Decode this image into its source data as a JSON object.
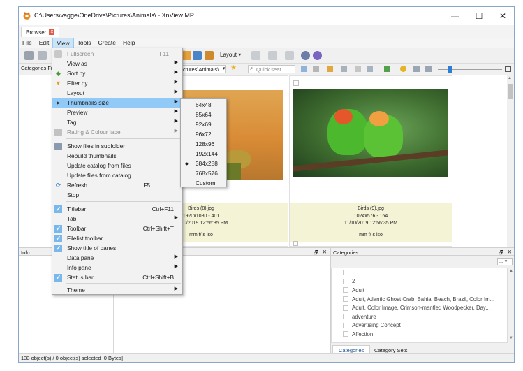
{
  "window": {
    "title": "C:\\Users\\vagge\\OneDrive\\Pictures\\Animals\\ - XnView MP",
    "minimize": "—",
    "maximize": "☐",
    "close": "✕"
  },
  "tab": {
    "label": "Browser",
    "close": "x"
  },
  "menubar": [
    "File",
    "Edit",
    "View",
    "Tools",
    "Create",
    "Help"
  ],
  "toolbar": {
    "layout_label": "Layout",
    "path_text": "ctures\\Animals\\",
    "search_placeholder": "Quick sear..."
  },
  "left_pane": {
    "categories_filter_label": "Categories Fi"
  },
  "view_menu": [
    {
      "label": "Fullscreen",
      "shortcut": "F11",
      "disabled": true,
      "icon": "fullscreen-icon"
    },
    {
      "label": "View as",
      "submenu": true
    },
    {
      "label": "Sort by",
      "submenu": true,
      "icon": "sort-icon"
    },
    {
      "label": "Filter by",
      "submenu": true,
      "icon": "filter-icon"
    },
    {
      "label": "Layout",
      "submenu": true
    },
    {
      "label": "Thumbnails size",
      "submenu": true,
      "highlighted": true
    },
    {
      "label": "Preview",
      "submenu": true
    },
    {
      "label": "Tag",
      "submenu": true
    },
    {
      "label": "Rating & Colour label",
      "submenu": true,
      "disabled": true,
      "icon": "rating-icon"
    },
    {
      "separator": true
    },
    {
      "label": "Show files in subfolder",
      "icon": "subfolder-icon"
    },
    {
      "label": "Rebuild thumbnails"
    },
    {
      "label": "Update catalog from files"
    },
    {
      "label": "Update files from catalog"
    },
    {
      "label": "Refresh",
      "shortcut": "F5",
      "icon": "refresh-icon"
    },
    {
      "label": "Stop"
    },
    {
      "separator": true
    },
    {
      "label": "Titlebar",
      "shortcut": "Ctrl+F11",
      "checked": true
    },
    {
      "label": "Tab",
      "submenu": true
    },
    {
      "label": "Toolbar",
      "shortcut": "Ctrl+Shift+T",
      "checked": true
    },
    {
      "label": "Filelist toolbar",
      "checked": true
    },
    {
      "label": "Show title of panes",
      "checked": true
    },
    {
      "label": "Data pane",
      "submenu": true
    },
    {
      "label": "Info pane",
      "submenu": true
    },
    {
      "label": "Status bar",
      "shortcut": "Ctrl+Shift+B",
      "checked": true
    },
    {
      "separator": true
    },
    {
      "label": "Theme",
      "submenu": true
    }
  ],
  "thumb_sizes": [
    {
      "label": "64x48"
    },
    {
      "label": "85x64"
    },
    {
      "label": "92x69"
    },
    {
      "label": "96x72"
    },
    {
      "label": "128x96"
    },
    {
      "label": "192x144"
    },
    {
      "label": "384x288",
      "selected": true
    },
    {
      "label": "768x576"
    },
    {
      "label": "Custom"
    }
  ],
  "thumbnails": [
    {
      "name": "Birds (8).jpg",
      "dims": "1920x1080 - 401",
      "date": "11/10/2019 12:56:35 PM",
      "exif": "mm f/ s iso"
    },
    {
      "name": "Birds (9).jpg",
      "dims": "1024x576 - 164",
      "date": "11/10/2019 12:56:35 PM",
      "exif": "mm f/ s iso"
    }
  ],
  "info_pane": {
    "title": "Info",
    "float": "🗗",
    "close": "✕"
  },
  "categories_pane": {
    "title": "Categories",
    "dropdown": "...",
    "items": [
      "",
      "2",
      "Adult",
      "Adult, Atlantic Ghost Crab, Bahia, Beach, Brazil, Color Im...",
      "Adult, Color Image, Crimson-mantled Woodpecker, Day...",
      "adventure",
      "Advertising Concept",
      "Affection"
    ],
    "tabs": [
      "Categories",
      "Category Sets"
    ]
  },
  "status": "133 object(s) / 0 object(s) selected [0 Bytes]"
}
